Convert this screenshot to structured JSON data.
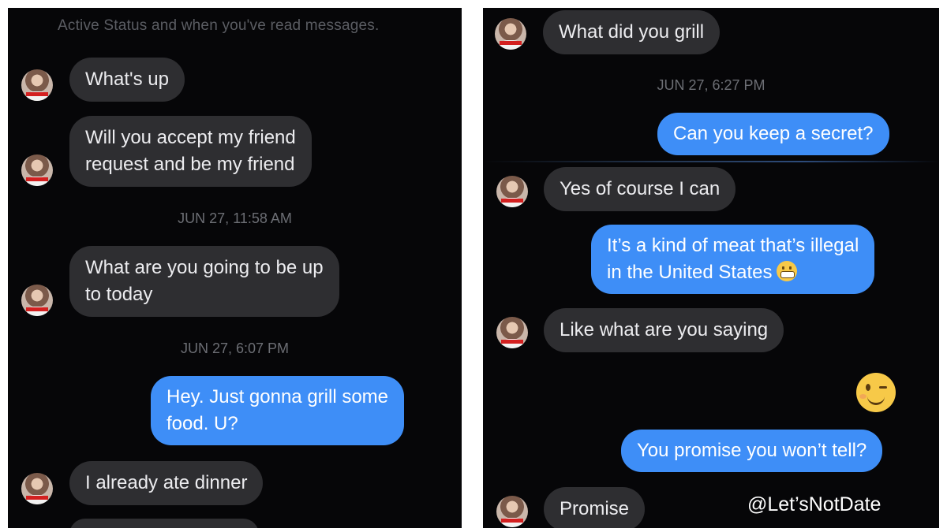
{
  "left_panel": {
    "status_note": "Active Status and when you've read messages.",
    "messages": [
      {
        "text": "What's up"
      },
      {
        "line1": "Will you accept my friend",
        "line2": "request and be my friend"
      },
      {
        "line1": "What are you going to be up",
        "line2": "to today"
      },
      {
        "line1": "Hey. Just gonna grill some",
        "line2": "food. U?"
      },
      {
        "text": "I already ate dinner"
      }
    ],
    "timestamps": [
      "JUN 27, 11:58 AM",
      "JUN 27, 6:07 PM"
    ]
  },
  "right_panel": {
    "messages": [
      {
        "text": "What did you grill"
      },
      {
        "text": "Can you keep a secret?"
      },
      {
        "text": "Yes of course I can"
      },
      {
        "line1": "It’s a kind of meat that’s illegal",
        "line2": "in the United States"
      },
      {
        "text": "Like what are you saying"
      },
      {
        "text": "You promise you won’t tell?"
      },
      {
        "text": "Promise"
      }
    ],
    "timestamps": [
      "JUN 27, 6:27 PM"
    ],
    "emoji_inline": "grimacing-face",
    "emoji_standalone": "winking-face"
  },
  "watermark": "@Let’sNotDate",
  "colors": {
    "background": "#060608",
    "incoming_bubble": "#2e2e31",
    "outgoing_bubble": "#3e8ef7"
  }
}
